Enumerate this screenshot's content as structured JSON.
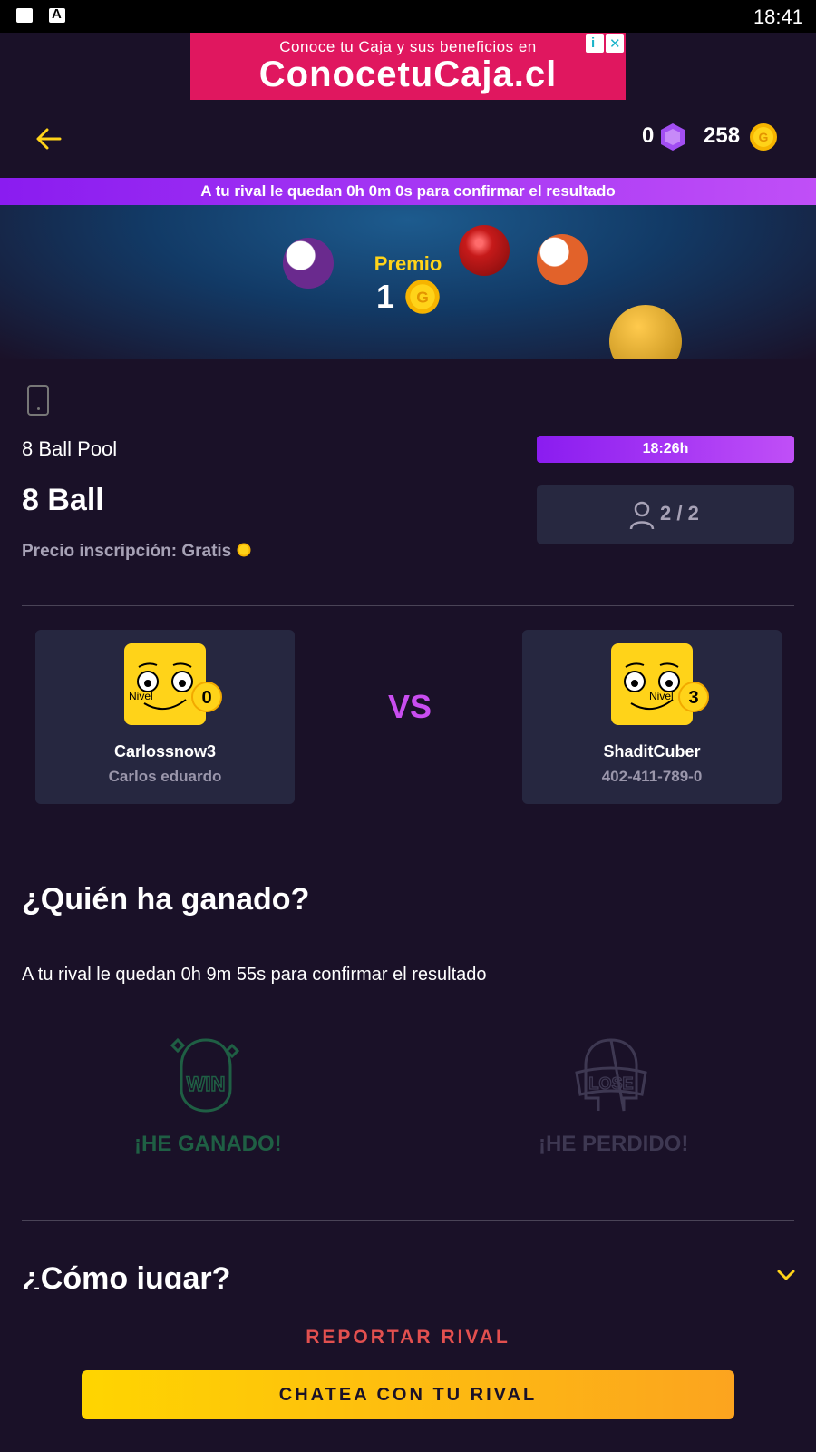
{
  "status_bar": {
    "time": "18:41"
  },
  "ad": {
    "line1": "Conoce tu Caja y sus beneficios en",
    "line2": "ConocetuCaja.cl",
    "info_label": "i",
    "close_label": "✕"
  },
  "header": {
    "gems": "0",
    "coins": "258"
  },
  "banner": {
    "text": "A tu rival le quedan 0h 0m 0s para confirmar el resultado"
  },
  "prize": {
    "label": "Premio",
    "value": "1"
  },
  "game": {
    "name": "8 Ball Pool",
    "mode": "8 Ball",
    "entry": "Precio inscripción: Gratis",
    "time": "18:26h",
    "players": "2 / 2"
  },
  "players": [
    {
      "username": "Carlossnow3",
      "subtitle": "Carlos eduardo",
      "level_word": "Nivel",
      "level": "0"
    },
    {
      "username": "ShaditCuber",
      "subtitle": "402-411-789-0",
      "level_word": "Nivel",
      "level": "3"
    }
  ],
  "vs_label": "VS",
  "result": {
    "title": "¿Quién ha ganado?",
    "subtitle": "A tu rival le quedan 0h 9m 55s para confirmar el resultado",
    "win_label": "¡HE GANADO!",
    "win_icon_text": "WIN",
    "lose_label": "¡HE PERDIDO!",
    "lose_icon_text": "LOSE"
  },
  "howto": {
    "title": "¿Cómo jugar?"
  },
  "actions": {
    "report": "REPORTAR RIVAL",
    "chat": "CHATEA CON TU RIVAL"
  },
  "colors": {
    "background": "#1a1128",
    "accent_purple": "#8a1cf0",
    "accent_yellow": "#ffd319",
    "report_red": "#e2504f"
  }
}
